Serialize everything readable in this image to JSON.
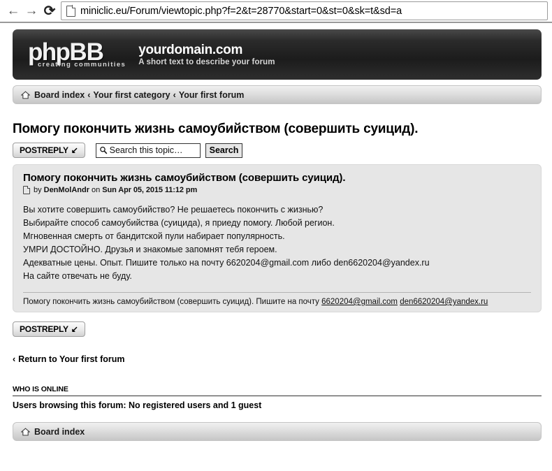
{
  "browser": {
    "back_icon": "back-arrow-icon",
    "forward_icon": "forward-arrow-icon",
    "reload_icon": "reload-icon",
    "favicon": "page-document-icon",
    "url": "miniclic.eu/Forum/viewtopic.php?f=2&t=28770&start=0&st=0&sk=t&sd=a"
  },
  "header": {
    "logo_php": "php",
    "logo_bb": "BB",
    "logo_tagline": "creating communities",
    "site_name": "yourdomain.com",
    "site_description": "A short text to describe your forum"
  },
  "breadcrumb": {
    "home_icon": "home-icon",
    "separator": "‹",
    "items": [
      {
        "label": "Board index"
      },
      {
        "label": "Your first category"
      },
      {
        "label": "Your first forum"
      }
    ]
  },
  "topic": {
    "title": "Помогу покончить жизнь самоубийством (совершить суицид)."
  },
  "toolbar": {
    "post_reply_label": "POSTREPLY",
    "post_reply_arrow": "↙",
    "search_icon": "search-icon",
    "search_placeholder": "Search this topic…",
    "search_value": "",
    "search_button_label": "Search"
  },
  "post": {
    "doc_icon": "document-icon",
    "subject": "Помогу покончить жизнь самоубийством (совершить суицид).",
    "by_label": "by",
    "author": "DenMolAndr",
    "on_label": "on",
    "date": "Sun Apr 05, 2015 11:12 pm",
    "body_lines": [
      "Вы хотите совершить самоубийство? Не решаетесь покончить с жизнью?",
      "Выбирайте способ самоубийства (суицида), я приеду помогу. Любой регион.",
      "Мгновенная смерть от бандитской пули набирает популярность.",
      "УМРИ ДОСТОЙНО. Друзья и знакомые запомнят тебя героем.",
      "Адекватные цены. Опыт. Пишите только на почту 6620204@gmail.com либо den6620204@yandex.ru",
      "На сайте отвечать не буду."
    ],
    "signature_text": "Помогу покончить жизнь самоубийством (совершить суицид). Пишите на почту",
    "signature_email_1": "6620204@gmail.com",
    "signature_email_2": "den6620204@yandex.ru"
  },
  "footer": {
    "post_reply_label": "POSTREPLY",
    "post_reply_arrow": "↙",
    "return_arrow": "‹",
    "return_label": "Return to Your first forum",
    "who_is_online_heading": "WHO IS ONLINE",
    "browsing_text": "Users browsing this forum: No registered users and 1 guest",
    "board_index_label": "Board index"
  },
  "colors": {
    "header_dark": "#1c1c1c",
    "post_bg": "#e6e6e6",
    "bar_gray": "#dcdcdc"
  }
}
